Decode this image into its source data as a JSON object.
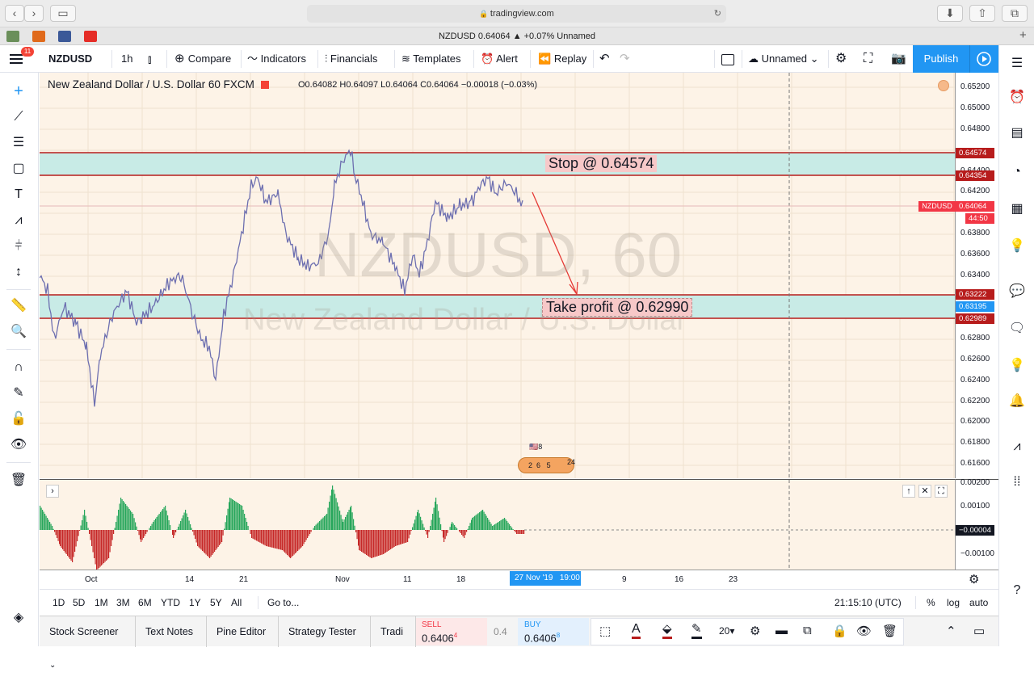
{
  "browser": {
    "url": "tradingview.com",
    "tab_title": "NZDUSD 0.64064 ▲ +0.07% Unnamed"
  },
  "toolbar": {
    "symbol": "NZDUSD",
    "interval": "1h",
    "compare": "Compare",
    "indicators": "Indicators",
    "financials": "Financials",
    "templates": "Templates",
    "alert": "Alert",
    "replay": "Replay",
    "layout_name": "Unnamed",
    "publish": "Publish",
    "notification_count": "11"
  },
  "legend": {
    "title": "New Zealand Dollar / U.S. Dollar",
    "interval": "60",
    "source": "FXCM",
    "ohlc": "O0.64082 H0.64097 L0.64064 C0.64064 −0.00018 (−0.03%)"
  },
  "watermark": {
    "line1": "NZDUSD, 60",
    "line2": "New Zealand Dollar / U.S. Dollar"
  },
  "annotations": {
    "stop": "Stop @ 0.64574",
    "take_profit": "Take profit @ 0.62990"
  },
  "price_axis": {
    "ticks": [
      "0.65200",
      "0.65000",
      "0.64800",
      "0.64400",
      "0.64200",
      "0.63800",
      "0.63600",
      "0.63400",
      "0.62800",
      "0.62600",
      "0.62400",
      "0.62200",
      "0.62000",
      "0.61800",
      "0.61600"
    ],
    "tags": {
      "stop_upper": "0.64574",
      "stop_lower": "0.64354",
      "symbol": "NZDUSD",
      "last": "0.64064",
      "countdown": "44:50",
      "tp_upper": "0.63222",
      "tp_mid": "0.63195",
      "tp_lower": "0.62989"
    }
  },
  "indicator_axis": {
    "ticks": [
      "0.00200",
      "0.00100",
      "−0.00100"
    ],
    "current": "−0.00004"
  },
  "time_axis": {
    "labels": [
      "Oct",
      "14",
      "21",
      "Nov",
      "11",
      "18",
      "9",
      "16",
      "23"
    ],
    "crosshair": "27 Nov '19",
    "crosshair_time": "19:00"
  },
  "bottom_bar": {
    "ranges": [
      "1D",
      "5D",
      "1M",
      "3M",
      "6M",
      "YTD",
      "1Y",
      "5Y",
      "All"
    ],
    "goto": "Go to...",
    "clock": "21:15:10 (UTC)",
    "percent": "%",
    "log": "log",
    "auto": "auto"
  },
  "panel": {
    "tabs": [
      "Stock Screener",
      "Text Notes",
      "Pine Editor",
      "Strategy Tester",
      "Tradi"
    ],
    "sell_label": "SELL",
    "sell_price": "0.6406",
    "sell_sup": "4",
    "spread": "0.4",
    "buy_label": "BUY",
    "buy_price": "0.6406",
    "buy_sup": "8",
    "line_width": "20"
  },
  "events": {
    "flag_count": "8",
    "e1": "2",
    "e2": "6",
    "e3": "5",
    "e4": "24"
  },
  "colors": {
    "accent": "#2196f3",
    "zone_fill": "#c8ebe6",
    "zone_line": "#b71c1c",
    "up": "#26a65b",
    "down": "#c62828",
    "candles": "#6d6fb0"
  }
}
